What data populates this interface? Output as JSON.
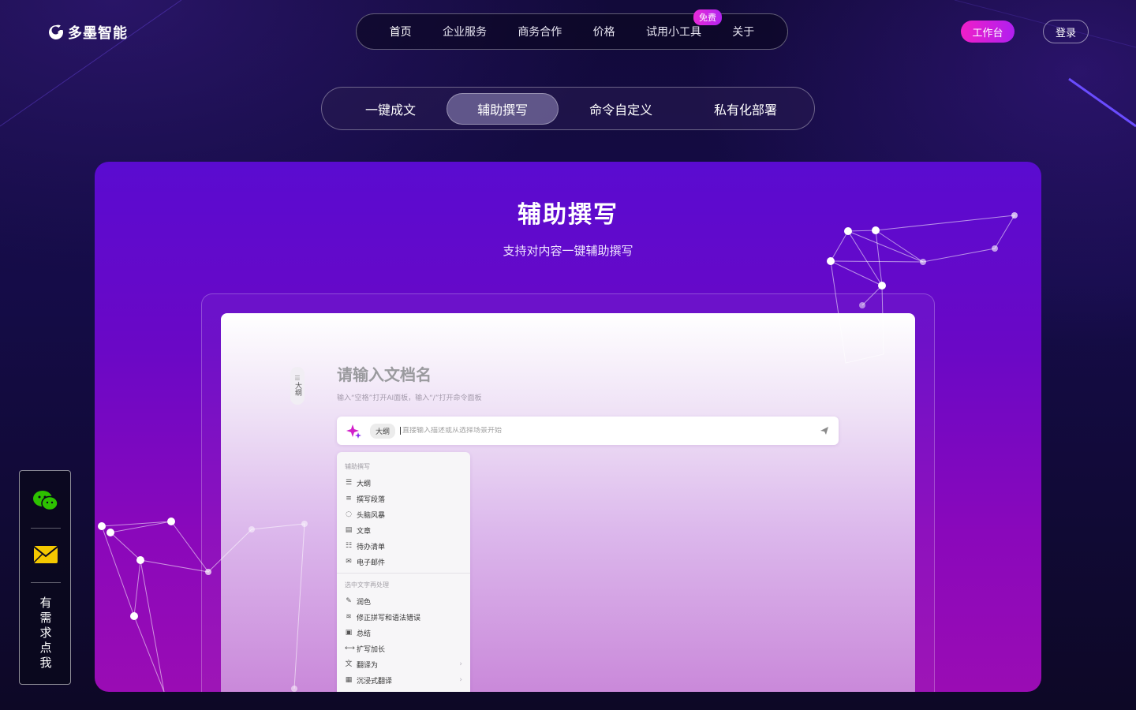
{
  "brand": {
    "name": "多墨智能"
  },
  "nav": {
    "items": [
      {
        "label": "首页"
      },
      {
        "label": "企业服务"
      },
      {
        "label": "商务合作"
      },
      {
        "label": "价格"
      },
      {
        "label": "试用小工具"
      },
      {
        "label": "关于"
      }
    ],
    "free_badge": "免费"
  },
  "header": {
    "workbench_label": "工作台",
    "login_label": "登录"
  },
  "feature_tabs": [
    {
      "label": "一键成文"
    },
    {
      "label": "辅助撰写",
      "active": true
    },
    {
      "label": "命令自定义"
    },
    {
      "label": "私有化部署"
    }
  ],
  "hero": {
    "title": "辅助撰写",
    "subtitle": "支持对内容一键辅助撰写"
  },
  "editor": {
    "outline_label": "大纲",
    "doc_title_placeholder": "请输入文档名",
    "hint": "输入“空格”打开AI面板，输入“/”打开命令面板",
    "prompt": {
      "chip": "大纲",
      "placeholder": "直接输入描述或从选择场景开始"
    },
    "menu": {
      "group1": "辅助撰写",
      "items1": [
        "大纲",
        "撰写段落",
        "头脑风暴",
        "文章",
        "待办清单",
        "电子邮件"
      ],
      "group2": "选中文字再处理",
      "items2": [
        "润色",
        "修正拼写和语法错误",
        "总结",
        "扩写加长",
        "翻译为",
        "沉浸式翻译"
      ]
    }
  },
  "contact": {
    "need_label": "有\n需\n求\n点\n我"
  },
  "colors": {
    "accent_pink": "#f01fc8",
    "accent_purple": "#b01ff0",
    "card_top": "#5a0bd0",
    "card_bottom": "#9a0cb4"
  }
}
